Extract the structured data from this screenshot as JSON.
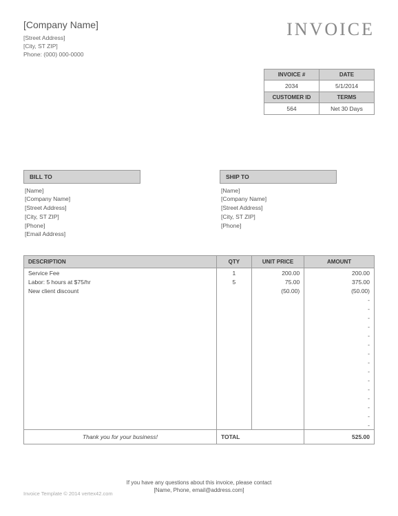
{
  "title": "INVOICE",
  "company": {
    "name": "[Company Name]",
    "street": "[Street Address]",
    "city": "[City, ST  ZIP]",
    "phone": "Phone: (000) 000-0000"
  },
  "meta": {
    "invoice_hdr": "INVOICE #",
    "date_hdr": "DATE",
    "cust_hdr": "CUSTOMER ID",
    "terms_hdr": "TERMS",
    "invoice": "2034",
    "date": "5/1/2014",
    "customer": "564",
    "terms": "Net 30 Days"
  },
  "bill": {
    "hdr": "BILL TO",
    "name": "[Name]",
    "company": "[Company Name]",
    "street": "[Street Address]",
    "city": "[City, ST  ZIP]",
    "phone": "[Phone]",
    "email": "[Email Address]"
  },
  "ship": {
    "hdr": "SHIP TO",
    "name": "[Name]",
    "company": "[Company Name]",
    "street": "[Street Address]",
    "city": "[City, ST  ZIP]",
    "phone": "[Phone]"
  },
  "cols": {
    "desc": "DESCRIPTION",
    "qty": "QTY",
    "price": "UNIT PRICE",
    "amount": "AMOUNT"
  },
  "rows": [
    {
      "desc": "Service Fee",
      "qty": "1",
      "price": "200.00",
      "amount": "200.00"
    },
    {
      "desc": "Labor: 5 hours at $75/hr",
      "qty": "5",
      "price": "75.00",
      "amount": "375.00"
    },
    {
      "desc": "New client discount",
      "qty": "",
      "price": "(50.00)",
      "amount": "(50.00)"
    },
    {
      "desc": "",
      "qty": "",
      "price": "",
      "amount": "-"
    },
    {
      "desc": "",
      "qty": "",
      "price": "",
      "amount": "-"
    },
    {
      "desc": "",
      "qty": "",
      "price": "",
      "amount": "-"
    },
    {
      "desc": "",
      "qty": "",
      "price": "",
      "amount": "-"
    },
    {
      "desc": "",
      "qty": "",
      "price": "",
      "amount": "-"
    },
    {
      "desc": "",
      "qty": "",
      "price": "",
      "amount": "-"
    },
    {
      "desc": "",
      "qty": "",
      "price": "",
      "amount": "-"
    },
    {
      "desc": "",
      "qty": "",
      "price": "",
      "amount": "-"
    },
    {
      "desc": "",
      "qty": "",
      "price": "",
      "amount": "-"
    },
    {
      "desc": "",
      "qty": "",
      "price": "",
      "amount": "-"
    },
    {
      "desc": "",
      "qty": "",
      "price": "",
      "amount": "-"
    },
    {
      "desc": "",
      "qty": "",
      "price": "",
      "amount": "-"
    },
    {
      "desc": "",
      "qty": "",
      "price": "",
      "amount": "-"
    },
    {
      "desc": "",
      "qty": "",
      "price": "",
      "amount": "-"
    },
    {
      "desc": "",
      "qty": "",
      "price": "",
      "amount": "-"
    }
  ],
  "thanks": "Thank you for your business!",
  "total_label": "TOTAL",
  "total": "525.00",
  "contact1": "If you have any questions about this invoice, please contact",
  "contact2": "[Name, Phone, email@address.com]",
  "copyright": "Invoice Template © 2014 vertex42.com"
}
